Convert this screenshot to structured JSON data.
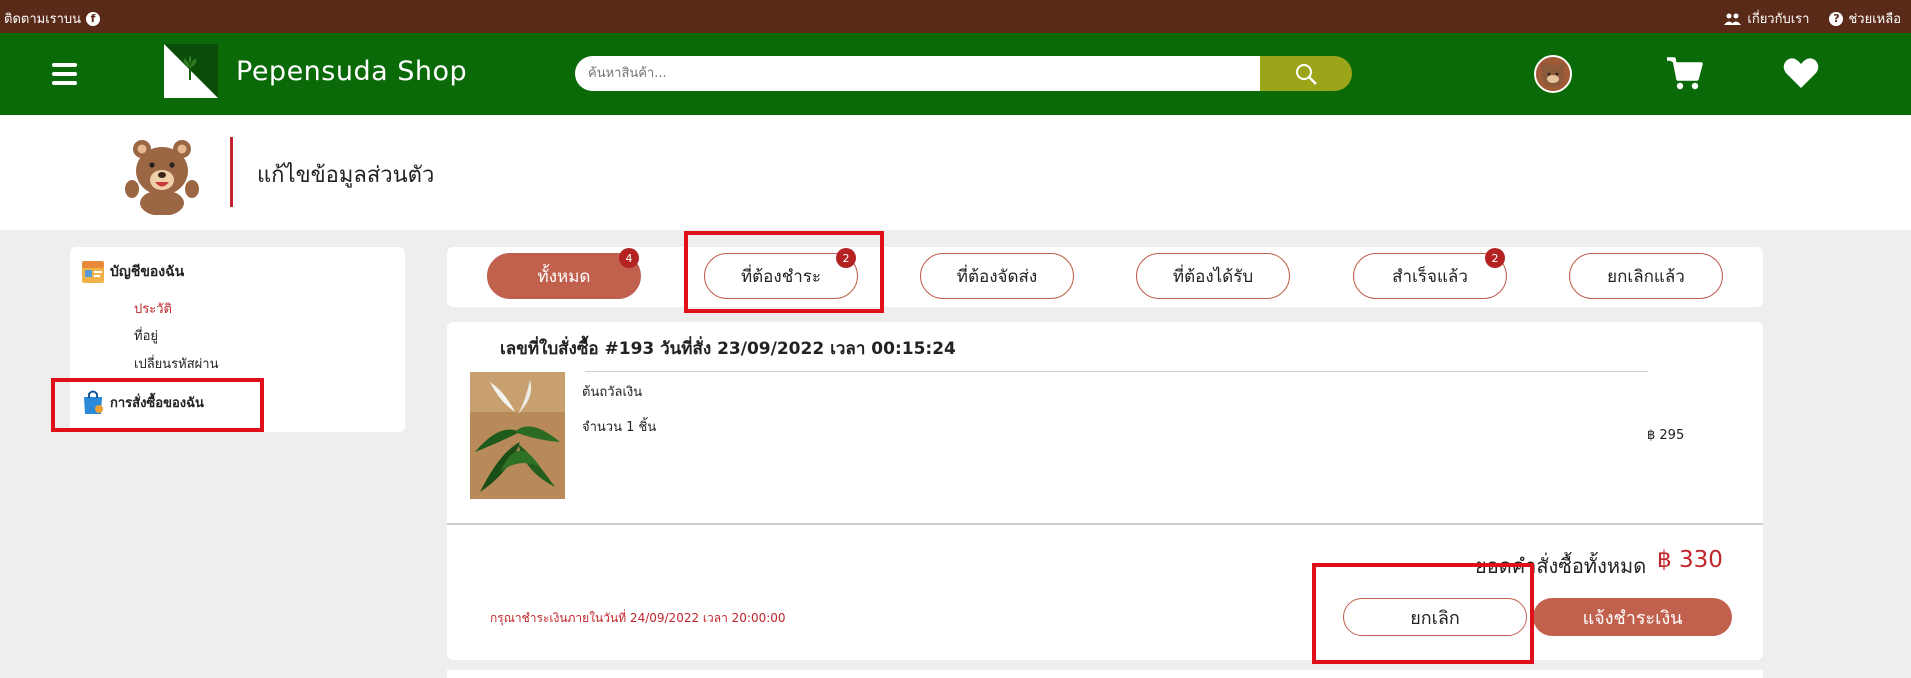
{
  "topbar": {
    "follow_label": "ติดตามเราบน",
    "about_label": "เกี่ยวกับเรา",
    "help_label": "ช่วยเหลือ"
  },
  "header": {
    "brand": "Pepensuda Shop",
    "search_placeholder": "ค้นหาสินค้า..."
  },
  "profile": {
    "title": "แก้ไขข้อมูลส่วนตัว"
  },
  "sidebar": {
    "account_label": "บัญชีของฉัน",
    "items": [
      {
        "label": "ประวัติ",
        "active": true
      },
      {
        "label": "ที่อยู่",
        "active": false
      },
      {
        "label": "เปลี่ยนรหัสผ่าน",
        "active": false
      }
    ],
    "orders_label": "การสั่งซื้อของฉัน"
  },
  "tabs": [
    {
      "label": "ทั้งหมด",
      "badge": "4",
      "active": true
    },
    {
      "label": "ที่ต้องชำระ",
      "badge": "2",
      "active": false
    },
    {
      "label": "ที่ต้องจัดส่ง",
      "badge": "",
      "active": false
    },
    {
      "label": "ที่ต้องได้รับ",
      "badge": "",
      "active": false
    },
    {
      "label": "สำเร็จแล้ว",
      "badge": "2",
      "active": false
    },
    {
      "label": "ยกเลิกแล้ว",
      "badge": "",
      "active": false
    }
  ],
  "order": {
    "title": "เลขที่ใบสั่งซื้อ #193 วันที่สั่ง 23/09/2022 เวลา 00:15:24",
    "product_name": "ต้นถวัลเงิน",
    "quantity": "จำนวน 1 ชิ้น",
    "price": "฿ 295",
    "total_label": "ยอดคำสั่งซื้อทั้งหมด",
    "total_value": "฿ 330",
    "deadline": "กรุณาชำระเงินภายในวันที่ 24/09/2022 เวลา 20:00:00",
    "cancel_label": "ยกเลิก",
    "pay_label": "แจ้งชำระเงิน"
  },
  "colors": {
    "topbar": "#5a2a18",
    "header": "#0b6a08",
    "accent": "#c2604e",
    "highlight": "#e0101a",
    "price_red": "#c0262c"
  }
}
